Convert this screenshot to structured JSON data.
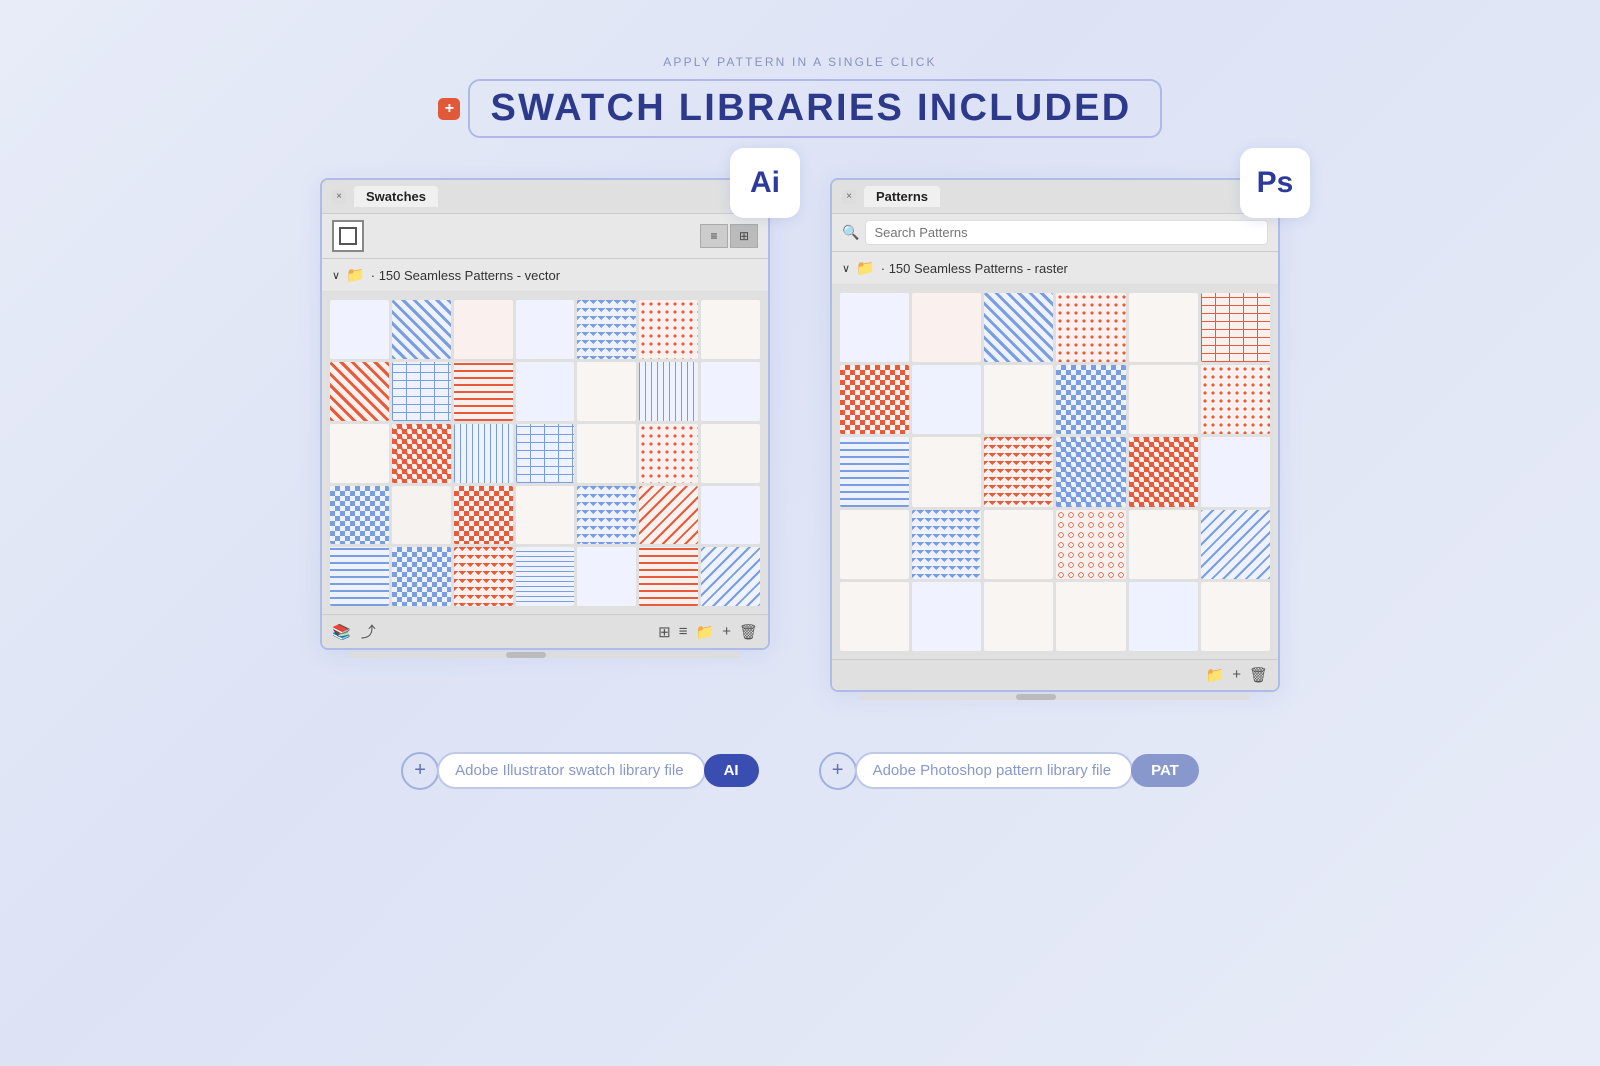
{
  "page": {
    "background": "#dde3f5"
  },
  "header": {
    "subtitle": "APPLY PATTERN IN A SINGLE CLICK",
    "title": "SWATCH LIBRARIES INCLUDED",
    "plus_icon": "+"
  },
  "ai_panel": {
    "app_badge": "Ai",
    "close_btn": "×",
    "title": "Swatches",
    "menu_icon": "≡",
    "view_list_icon": "≡",
    "view_grid_icon": "⊞",
    "folder_label": "· 150 Seamless Patterns - vector",
    "scrollbar_visible": true
  },
  "ps_panel": {
    "app_badge": "Ps",
    "close_btn": "×",
    "title": "Patterns",
    "menu_icon": "≡",
    "search_placeholder": "Search Patterns",
    "folder_label": "· 150 Seamless Patterns - raster",
    "scrollbar_visible": true
  },
  "ai_bottom_toolbar": {
    "icons": [
      "📚",
      "⤴",
      "⊞",
      "≡",
      "📁",
      "+",
      "🗑"
    ]
  },
  "ps_bottom_toolbar": {
    "icons": [
      "📁",
      "+",
      "🗑"
    ]
  },
  "file_tags": [
    {
      "label": "Adobe Illustrator swatch library file",
      "badge": "AI",
      "badge_class": "badge-ai"
    },
    {
      "label": "Adobe Photoshop pattern library file",
      "badge": "PAT",
      "badge_class": "badge-pat"
    }
  ]
}
